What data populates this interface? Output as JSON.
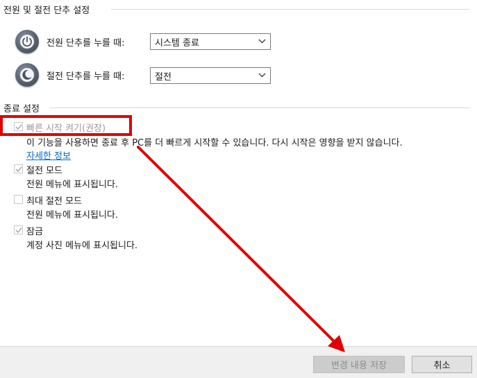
{
  "sections": {
    "power_buttons": "전원 및 절전 단추 설정",
    "shutdown": "종료 설정"
  },
  "power_button": {
    "label": "전원 단추를 누를 때:",
    "value": "시스템 종료"
  },
  "sleep_button": {
    "label": "절전 단추를 누를 때:",
    "value": "절전"
  },
  "options": {
    "fast_startup": {
      "label": "빠른 시작 켜기(권장)",
      "description": "이 기능을 사용하면 종료 후 PC를 더 빠르게 시작할 수 있습니다. 다시 시작은 영향을 받지 않습니다.",
      "link": "자세한 정보",
      "checked": true,
      "enabled": false
    },
    "sleep": {
      "label": "절전 모드",
      "description": "전원 메뉴에 표시됩니다.",
      "checked": true,
      "enabled": false
    },
    "hibernate": {
      "label": "최대 절전 모드",
      "description": "전원 메뉴에 표시됩니다.",
      "checked": false,
      "enabled": false
    },
    "lock": {
      "label": "잠금",
      "description": "계정 사진 메뉴에 표시됩니다.",
      "checked": true,
      "enabled": false
    }
  },
  "footer": {
    "save_label": "변경 내용 저장",
    "cancel_label": "취소"
  },
  "colors": {
    "annotation": "#e00000",
    "link": "#0066cc"
  },
  "icons": {
    "power": "power-icon",
    "sleep": "moon-icon",
    "checkmark": "checkmark-icon",
    "dropdown": "chevron-down-icon"
  }
}
